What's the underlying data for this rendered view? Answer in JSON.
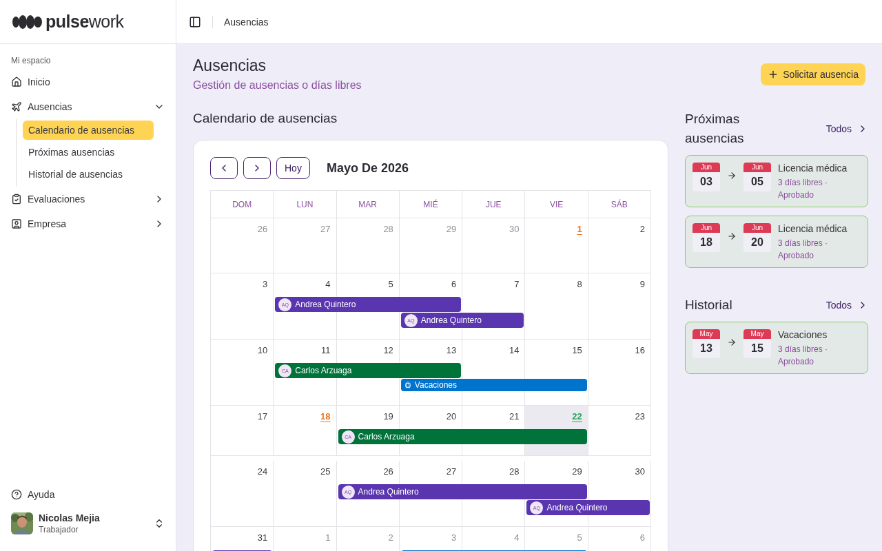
{
  "logo": "**pulse**work",
  "sidebar": {
    "section": "Mi espacio",
    "items": [
      {
        "label": "Inicio"
      },
      {
        "label": "Ausencias",
        "expanded": true,
        "children": [
          {
            "label": "Calendario de ausencias",
            "selected": true
          },
          {
            "label": "Próximas ausencias",
            "selected": false
          },
          {
            "label": "Historial de ausencias",
            "selected": false
          }
        ]
      },
      {
        "label": "Evaluaciones",
        "expanded": false
      },
      {
        "label": "Empresa",
        "expanded": false
      }
    ],
    "help": "Ayuda",
    "user": {
      "name": "Nicolas Mejia",
      "role": "Trabajador"
    }
  },
  "breadcrumb": "Ausencias",
  "page": {
    "title": "Ausencias",
    "subtitle": "Gestión de ausencias o días libres",
    "action": "Solicitar ausencia"
  },
  "calendar": {
    "heading": "Calendario de ausencias",
    "today_button": "Hoy",
    "month": "Mayo De 2026",
    "weekdays": [
      "DOM",
      "LUN",
      "MAR",
      "MIÉ",
      "JUE",
      "VIE",
      "SÁB"
    ],
    "weeks": [
      {
        "days": [
          {
            "n": "26",
            "kind": "outside"
          },
          {
            "n": "27",
            "kind": "outside"
          },
          {
            "n": "28",
            "kind": "outside"
          },
          {
            "n": "29",
            "kind": "outside"
          },
          {
            "n": "30",
            "kind": "outside"
          },
          {
            "n": "1",
            "kind": "holiday"
          },
          {
            "n": "2",
            "kind": "normal"
          }
        ]
      },
      {
        "days": [
          {
            "n": "3",
            "kind": "normal"
          },
          {
            "n": "4",
            "kind": "normal"
          },
          {
            "n": "5",
            "kind": "normal"
          },
          {
            "n": "6",
            "kind": "normal"
          },
          {
            "n": "7",
            "kind": "normal"
          },
          {
            "n": "8",
            "kind": "normal"
          },
          {
            "n": "9",
            "kind": "normal"
          }
        ],
        "events": [
          {
            "kind": "person",
            "initials": "AQ",
            "label": "Andrea Quintero",
            "color": "#5a35b0",
            "covers": [
              false,
              true,
              true,
              true,
              false,
              false,
              false
            ]
          },
          {
            "kind": "person",
            "initials": "AQ",
            "label": "Andrea Quintero",
            "color": "#5a35b0",
            "covers": [
              false,
              false,
              false,
              true,
              true,
              false,
              false
            ]
          }
        ]
      },
      {
        "days": [
          {
            "n": "10",
            "kind": "normal"
          },
          {
            "n": "11",
            "kind": "normal"
          },
          {
            "n": "12",
            "kind": "normal"
          },
          {
            "n": "13",
            "kind": "normal"
          },
          {
            "n": "14",
            "kind": "normal"
          },
          {
            "n": "15",
            "kind": "normal"
          },
          {
            "n": "16",
            "kind": "normal"
          }
        ],
        "events": [
          {
            "kind": "person",
            "initials": "CA",
            "label": "Carlos Arzuaga",
            "color": "#00733b",
            "covers": [
              false,
              true,
              true,
              true,
              false,
              false,
              false
            ]
          },
          {
            "kind": "type",
            "label": "Vacaciones",
            "color": "#0073cc",
            "covers": [
              false,
              false,
              false,
              true,
              true,
              true,
              false
            ]
          }
        ]
      },
      {
        "days": [
          {
            "n": "17",
            "kind": "normal"
          },
          {
            "n": "18",
            "kind": "holiday"
          },
          {
            "n": "19",
            "kind": "normal"
          },
          {
            "n": "20",
            "kind": "normal"
          },
          {
            "n": "21",
            "kind": "normal"
          },
          {
            "n": "22",
            "kind": "today"
          },
          {
            "n": "23",
            "kind": "normal"
          }
        ],
        "events": [
          {
            "kind": "person",
            "initials": "CA",
            "label": "Carlos Arzuaga",
            "color": "#00733b",
            "covers": [
              false,
              false,
              true,
              true,
              true,
              true,
              false
            ]
          }
        ]
      },
      {
        "days": [
          {
            "n": "24",
            "kind": "normal"
          },
          {
            "n": "25",
            "kind": "normal"
          },
          {
            "n": "26",
            "kind": "normal"
          },
          {
            "n": "27",
            "kind": "normal"
          },
          {
            "n": "28",
            "kind": "normal"
          },
          {
            "n": "29",
            "kind": "normal"
          },
          {
            "n": "30",
            "kind": "normal"
          }
        ],
        "events": [
          {
            "kind": "person",
            "initials": "AQ",
            "label": "Andrea Quintero",
            "color": "#5a35b0",
            "covers": [
              false,
              false,
              true,
              true,
              true,
              true,
              false
            ]
          },
          {
            "kind": "person",
            "initials": "AQ",
            "label": "Andrea Quintero",
            "color": "#5a35b0",
            "covers": [
              false,
              false,
              false,
              false,
              false,
              true,
              true
            ]
          }
        ]
      },
      {
        "days": [
          {
            "n": "31",
            "kind": "normal"
          },
          {
            "n": "1",
            "kind": "outside"
          },
          {
            "n": "2",
            "kind": "outside"
          },
          {
            "n": "3",
            "kind": "outside"
          },
          {
            "n": "4",
            "kind": "outside"
          },
          {
            "n": "5",
            "kind": "outside"
          },
          {
            "n": "6",
            "kind": "outside"
          }
        ],
        "events": [
          {
            "kind": "bar",
            "color": "#5a35b0",
            "covers": [
              true,
              false,
              false,
              false,
              false,
              false,
              false
            ]
          },
          {
            "kind": "bar",
            "color": "#0073cc",
            "covers": [
              false,
              false,
              false,
              true,
              true,
              true,
              false
            ]
          }
        ]
      }
    ]
  },
  "upcoming": {
    "title": "Próximas ausencias",
    "link": "Todos",
    "items": [
      {
        "from_month": "Jun",
        "from_day": "03",
        "to_month": "Jun",
        "to_day": "05",
        "type": "Licencia médica",
        "detail": "3 días libres · Aprobado"
      },
      {
        "from_month": "Jun",
        "from_day": "18",
        "to_month": "Jun",
        "to_day": "20",
        "type": "Licencia médica",
        "detail": "3 días libres · Aprobado"
      }
    ]
  },
  "history": {
    "title": "Historial",
    "link": "Todos",
    "items": [
      {
        "from_month": "May",
        "from_day": "13",
        "to_month": "May",
        "to_day": "15",
        "type": "Vacaciones",
        "detail": "3 días libres · Aprobado"
      }
    ]
  }
}
